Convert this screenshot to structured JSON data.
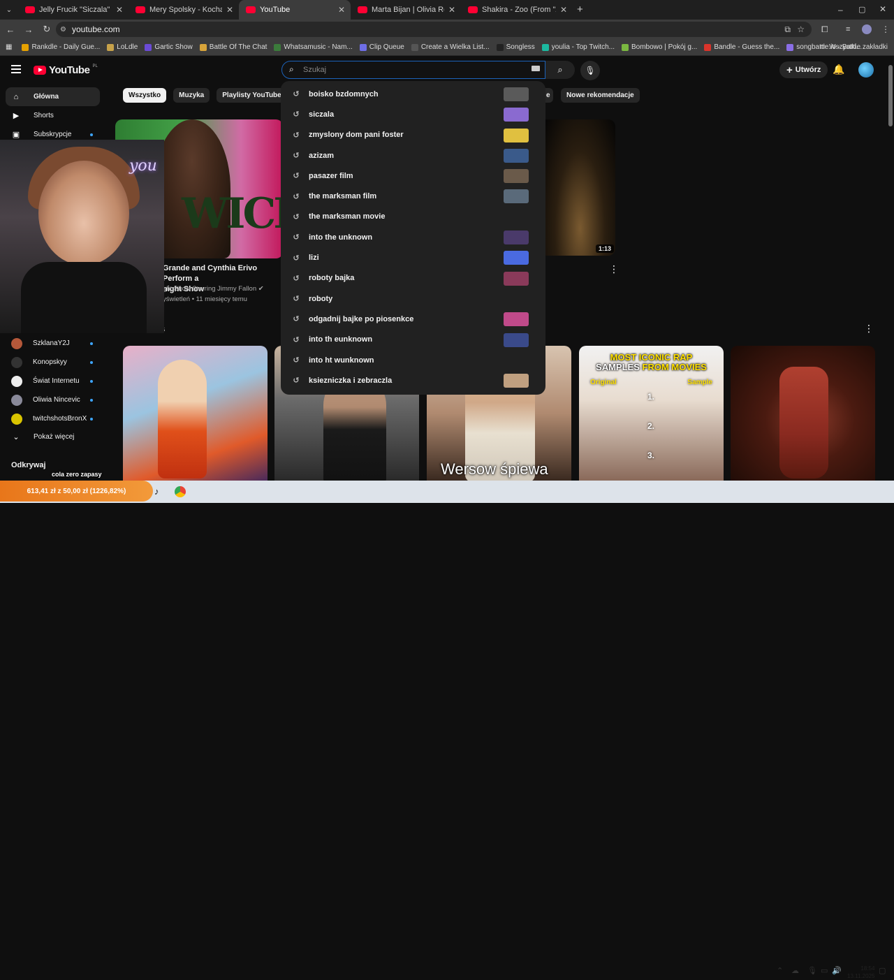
{
  "browser": {
    "tabs": [
      {
        "title": "Jelly Frucik \"Siczala\" (Official Vi",
        "active": false
      },
      {
        "title": "Mery Spolsky - Kocham Polskę",
        "active": false
      },
      {
        "title": "YouTube",
        "active": true
      },
      {
        "title": "Marta Bijan | Olivia Rodrigo \"Tr",
        "active": false
      },
      {
        "title": "Shakira - Zoo (From \"Zootopia",
        "active": false
      }
    ],
    "new_tab": "+",
    "url": "youtube.com",
    "bookmarks": [
      {
        "label": "Rankdle - Daily Gue...",
        "color": "#e6a100"
      },
      {
        "label": "LoLdle",
        "color": "#c7a24a"
      },
      {
        "label": "Gartic Show",
        "color": "#6b4bd6"
      },
      {
        "label": "Battle Of The Chat",
        "color": "#d8a43a"
      },
      {
        "label": "Whatsamusic - Nam...",
        "color": "#3b7b3b"
      },
      {
        "label": "Clip Queue",
        "color": "#6e6ee6"
      },
      {
        "label": "Create a Wielka List...",
        "color": "#555555"
      },
      {
        "label": "Songless",
        "color": "#222222"
      },
      {
        "label": "youlia - Top Twitch...",
        "color": "#1cb9a0"
      },
      {
        "label": "Bombowo | Pokój g...",
        "color": "#7bb841"
      },
      {
        "label": "Bandle - Guess the...",
        "color": "#d9342b"
      },
      {
        "label": "songbattle.io - Battl...",
        "color": "#8a6ee6"
      }
    ],
    "all_bookmarks": "Wszystkie zakładki"
  },
  "header": {
    "logo": "YouTube",
    "country": "PL",
    "search_placeholder": "Szukaj",
    "create_label": "Utwórz"
  },
  "sidebar": {
    "items": [
      {
        "label": "Główna",
        "icon": "home-icon",
        "active": true
      },
      {
        "label": "Shorts",
        "icon": "shorts-icon",
        "active": false
      },
      {
        "label": "Subskrypcje",
        "icon": "subscriptions-icon",
        "active": false
      }
    ],
    "channels": [
      {
        "label": "SzklanaY2J",
        "color": "#b5583a"
      },
      {
        "label": "Konopskyy",
        "color": "#333333"
      },
      {
        "label": "Świat Internetu",
        "color": "#eeeeee"
      },
      {
        "label": "Oliwia Nincevic",
        "color": "#8a8a9a"
      },
      {
        "label": "twitchshotsBronX",
        "color": "#d9c400"
      }
    ],
    "show_more": "Pokaż więcej",
    "explore": "Odkrywaj"
  },
  "chips": [
    "Wszystko",
    "Muzyka",
    "Playlisty YouTube Mix"
  ],
  "chips_right": [
    "e",
    "Nowe rekomendacje"
  ],
  "featured": {
    "title_line1": "Grande and Cynthia Erivo Perform a",
    "title_line2": "night Show",
    "channel": "ght Show Starring Jimmy Fallon",
    "meta": "yświetleń • 11 miesięcy temu",
    "thumb_text": "WICKED",
    "neon": "you",
    "right_duration": "1:13"
  },
  "shelf_title": "s",
  "shorts_cards": {
    "card4_title_line1": "MOST ICONIC RAP",
    "card4_title_line2a": "SAMPLES ",
    "card4_title_line2b": "FROM MOVIES",
    "card4_original": "Original",
    "card4_sample": "Sample",
    "card4_nums": [
      "1.",
      "2.",
      "3."
    ],
    "card3_caption": "Wersow śpiewa"
  },
  "suggestions": [
    {
      "text": "boisko bzdomnych",
      "thumb": "#5a5a5a"
    },
    {
      "text": "siczala",
      "thumb": "#8a6ad0"
    },
    {
      "text": "zmyslony dom pani foster",
      "thumb": "#e0c040"
    },
    {
      "text": "azizam",
      "thumb": "#3a5a8a"
    },
    {
      "text": "pasazer film",
      "thumb": "#6a5a4a"
    },
    {
      "text": "the marksman film",
      "thumb": "#5a6a7a"
    },
    {
      "text": "the marksman movie",
      "thumb": ""
    },
    {
      "text": "into the unknown",
      "thumb": "#4a3a6a"
    },
    {
      "text": "lizi",
      "thumb": "#4a6ae0"
    },
    {
      "text": "roboty bajka",
      "thumb": "#8a3a5a"
    },
    {
      "text": "roboty",
      "thumb": ""
    },
    {
      "text": "odgadnij bajke po piosenkce",
      "thumb": "#c04a8a"
    },
    {
      "text": "into th eunknown",
      "thumb": "#3a4a8a"
    },
    {
      "text": "into ht wunknown",
      "thumb": ""
    },
    {
      "text": "ksiezniczka i zebraczla",
      "thumb": "#c0a080"
    }
  ],
  "overlay": {
    "ticker": "613,41 zł z 50,00 zł (1226,82%)",
    "cola": "cola zero zapasy"
  },
  "taskbar": {
    "time": "18:54",
    "date": "13.11.2025"
  }
}
